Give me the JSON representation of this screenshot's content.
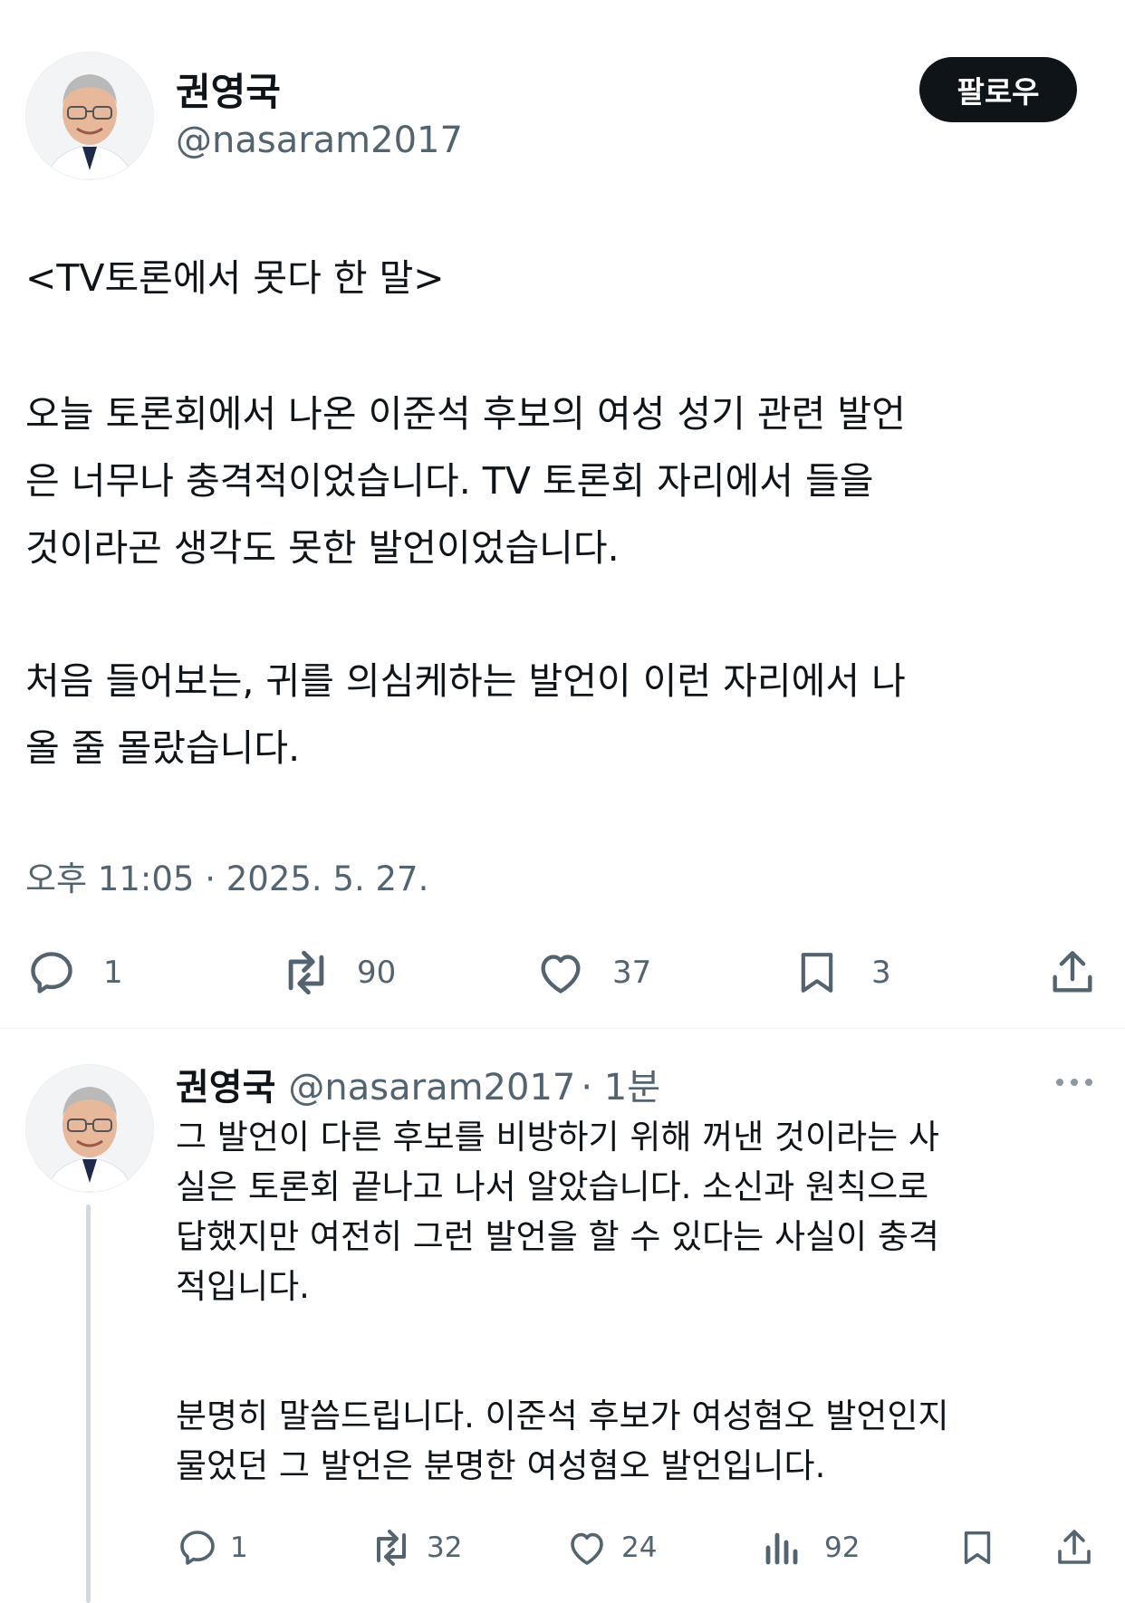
{
  "main_tweet": {
    "author": {
      "name": "권영국",
      "handle": "@nasaram2017"
    },
    "follow_label": "팔로우",
    "title": "<TV토론에서 못다 한 말>",
    "paragraph1": "오늘 토론회에서 나온 이준석 후보의 여성 성기 관련 발언\n은 너무나 충격적이었습니다. TV 토론회 자리에서 들을\n것이라곤 생각도 못한 발언이었습니다.",
    "paragraph2": "처음 들어보는, 귀를 의심케하는 발언이 이런 자리에서 나\n올 줄 몰랐습니다.",
    "timestamp": "오후 11:05 · 2025. 5. 27.",
    "stats": {
      "replies": "1",
      "reposts": "90",
      "likes": "37",
      "bookmarks": "3"
    }
  },
  "reply_tweet": {
    "author": {
      "name": "권영국",
      "handle": "@nasaram2017"
    },
    "time": "· 1분",
    "paragraph1": "그 발언이 다른 후보를 비방하기 위해 꺼낸 것이라는 사\n실은 토론회 끝나고 나서 알았습니다. 소신과 원칙으로\n답했지만 여전히 그런 발언을 할 수 있다는 사실이 충격\n적입니다.",
    "paragraph2": "분명히 말씀드립니다. 이준석 후보가 여성혐오 발언인지\n물었던 그 발언은 분명한 여성혐오 발언입니다.",
    "stats": {
      "replies": "1",
      "reposts": "32",
      "likes": "24",
      "views": "92"
    }
  },
  "icons": {
    "reply": "reply-icon",
    "repost": "repost-icon",
    "like": "heart-icon",
    "bookmark": "bookmark-icon",
    "share": "share-icon",
    "views": "views-icon",
    "more": "more-icon"
  },
  "colors": {
    "text": "#0f1419",
    "secondary": "#536471",
    "button_bg": "#0f1419",
    "divider": "#eff3f4",
    "thread_line": "#cfd9de"
  }
}
